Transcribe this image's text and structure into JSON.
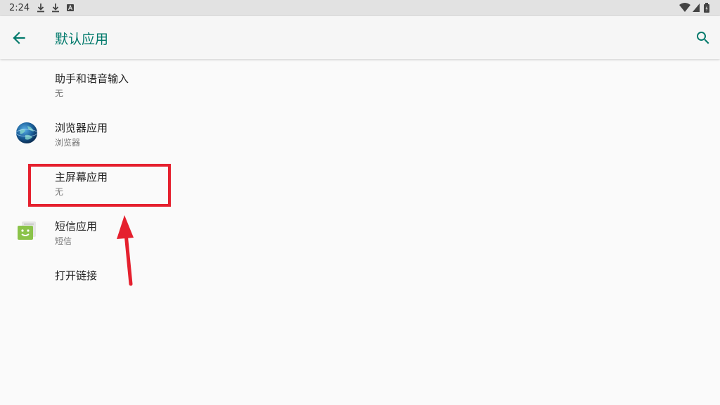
{
  "status_bar": {
    "time": "2:24"
  },
  "toolbar": {
    "title": "默认应用"
  },
  "items": [
    {
      "label": "助手和语音输入",
      "summary": "无"
    },
    {
      "label": "浏览器应用",
      "summary": "浏览器"
    },
    {
      "label": "主屏幕应用",
      "summary": "无"
    },
    {
      "label": "短信应用",
      "summary": "短信"
    },
    {
      "label": "打开链接"
    }
  ],
  "colors": {
    "accent": "#00796b",
    "highlight": "#e5202e",
    "background": "#fafafa"
  }
}
